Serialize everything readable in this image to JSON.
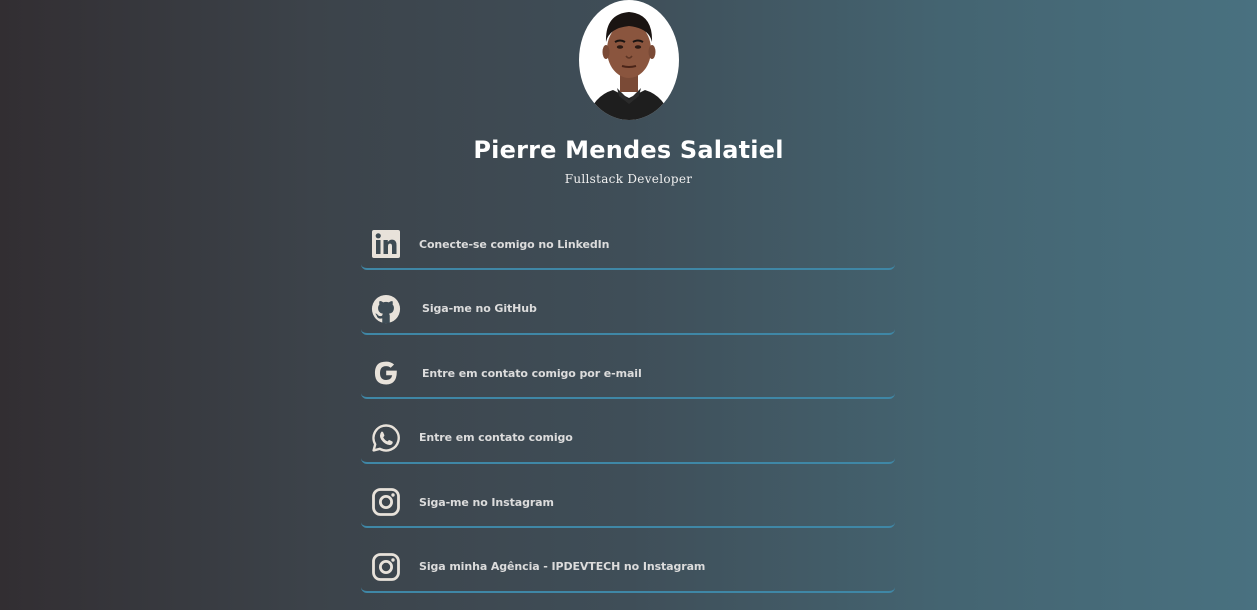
{
  "profile": {
    "name": "Pierre Mendes Salatiel",
    "role": "Fullstack Developer"
  },
  "links": [
    {
      "label": "Conecte-se comigo no LinkedIn",
      "icon": "linkedin-icon"
    },
    {
      "label": "Siga-me no GitHub",
      "icon": "github-icon"
    },
    {
      "label": "Entre em contato comigo por e-mail",
      "icon": "google-icon"
    },
    {
      "label": "Entre em contato comigo",
      "icon": "whatsapp-icon"
    },
    {
      "label": "Siga-me no Instagram",
      "icon": "instagram-icon"
    },
    {
      "label": "Siga minha Agência - IPDEVTECH no Instagram",
      "icon": "instagram-icon"
    }
  ],
  "colors": {
    "accent_border": "#3f87a6",
    "icon": "#e8e2da",
    "text": "#dcdcdc"
  }
}
